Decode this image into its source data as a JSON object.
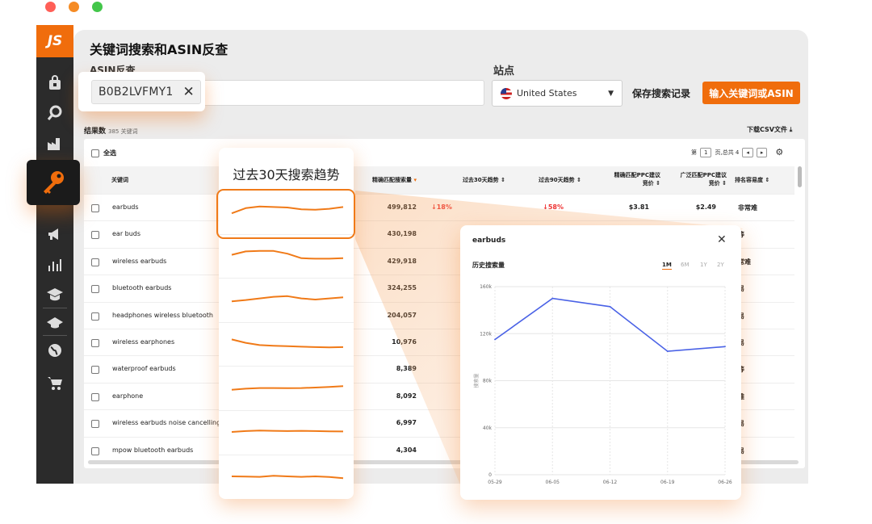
{
  "window": {
    "dots": [
      "#ff5f57",
      "#f58b24",
      "#43c64a"
    ]
  },
  "sidebar": {
    "logo": "JS",
    "icons": [
      "product-icon",
      "search-icon",
      "factory-icon",
      "key-icon",
      "megaphone-icon",
      "bar-chart-icon",
      "graduation-icon",
      "school-icon",
      "globe-icon",
      "cart-icon"
    ],
    "active_item": "key-icon"
  },
  "header": {
    "title": "关键词搜索和ASIN反查",
    "asin_label": "ASIN反查",
    "asin_value": "B0B2LVFMY1",
    "site_label": "站点",
    "site_value": "United States",
    "save_label": "保存搜索记录",
    "primary_label": "输入关键词或ASIN"
  },
  "results": {
    "label": "结果数",
    "count_text": "385 关键词",
    "csv_label": "下载CSV文件",
    "select_all": "全选",
    "pager": {
      "prefix": "第",
      "page": "1",
      "suffix": "页,总共 4"
    }
  },
  "table": {
    "headers": {
      "keyword": "关键词",
      "volume": "精确匹配搜索量",
      "trend30": "过去30天趋势",
      "trend90": "过去90天趋势",
      "ppc_exact_1": "精确匹配PPC建议",
      "ppc_exact_2": "竞价",
      "ppc_broad_1": "广泛匹配PPC建议",
      "ppc_broad_2": "竞价",
      "difficulty": "排名容易度"
    },
    "rows": [
      {
        "keyword": "earbuds",
        "volume": "499,812",
        "trend30": "↓18%",
        "trend90": "↓58%",
        "ppc_exact": "$3.81",
        "ppc_broad": "$2.49",
        "difficulty": "非常难"
      },
      {
        "keyword": "ear buds",
        "volume": "430,198",
        "trend30": "",
        "trend90": "",
        "ppc_exact": "",
        "ppc_broad": "",
        "difficulty": "等"
      },
      {
        "keyword": "wireless earbuds",
        "volume": "429,918",
        "trend30": "",
        "trend90": "",
        "ppc_exact": "",
        "ppc_broad": "",
        "difficulty": "常难"
      },
      {
        "keyword": "bluetooth earbuds",
        "volume": "324,255",
        "trend30": "",
        "trend90": "",
        "ppc_exact": "",
        "ppc_broad": "",
        "difficulty": "易"
      },
      {
        "keyword": "headphones wireless bluetooth",
        "volume": "204,057",
        "trend30": "",
        "trend90": "",
        "ppc_exact": "",
        "ppc_broad": "",
        "difficulty": "易"
      },
      {
        "keyword": "wireless earphones",
        "volume": "10,976",
        "trend30": "",
        "trend90": "",
        "ppc_exact": "",
        "ppc_broad": "",
        "difficulty": "易"
      },
      {
        "keyword": "waterproof earbuds",
        "volume": "8,389",
        "trend30": "",
        "trend90": "",
        "ppc_exact": "",
        "ppc_broad": "",
        "difficulty": "等"
      },
      {
        "keyword": "earphone",
        "volume": "8,092",
        "trend30": "",
        "trend90": "",
        "ppc_exact": "",
        "ppc_broad": "",
        "difficulty": "难"
      },
      {
        "keyword": "wireless earbuds noise cancelling",
        "volume": "6,997",
        "trend30": "",
        "trend90": "",
        "ppc_exact": "",
        "ppc_broad": "",
        "difficulty": "易"
      },
      {
        "keyword": "mpow bluetooth earbuds",
        "volume": "4,304",
        "trend30": "",
        "trend90": "",
        "ppc_exact": "",
        "ppc_broad": "",
        "difficulty": "易"
      }
    ]
  },
  "trend_panel": {
    "title": "过去30天搜索趋势",
    "sparklines": [
      [
        0.42,
        0.65,
        0.72,
        0.7,
        0.68,
        0.6,
        0.58,
        0.62,
        0.7
      ],
      [
        0.55,
        0.7,
        0.72,
        0.72,
        0.6,
        0.4,
        0.38,
        0.38,
        0.4
      ],
      [
        0.42,
        0.48,
        0.55,
        0.62,
        0.65,
        0.55,
        0.5,
        0.55,
        0.6
      ],
      [
        0.7,
        0.55,
        0.45,
        0.42,
        0.4,
        0.38,
        0.36,
        0.35,
        0.36
      ],
      [
        0.4,
        0.45,
        0.48,
        0.48,
        0.47,
        0.48,
        0.5,
        0.53,
        0.56
      ],
      [
        0.5,
        0.54,
        0.56,
        0.55,
        0.54,
        0.55,
        0.54,
        0.53,
        0.52
      ],
      [
        0.5,
        0.49,
        0.48,
        0.53,
        0.5,
        0.48,
        0.5,
        0.47,
        0.42
      ]
    ]
  },
  "popup": {
    "title": "earbuds",
    "subtitle": "历史搜索量",
    "ranges": [
      "1M",
      "6M",
      "1Y",
      "2Y"
    ],
    "active_range": "1M",
    "line_color": "#4a62e6",
    "chart_data": {
      "type": "line",
      "x": [
        "05-29",
        "06-05",
        "06-12",
        "06-19",
        "06-26"
      ],
      "series": [
        {
          "values": [
            115000,
            150000,
            143000,
            105000,
            109000
          ]
        }
      ],
      "ylim": [
        0,
        160000
      ],
      "yticks": [
        "0",
        "40k",
        "80k",
        "120k",
        "160k"
      ],
      "ylabel": "搜索量",
      "grid": true
    }
  }
}
